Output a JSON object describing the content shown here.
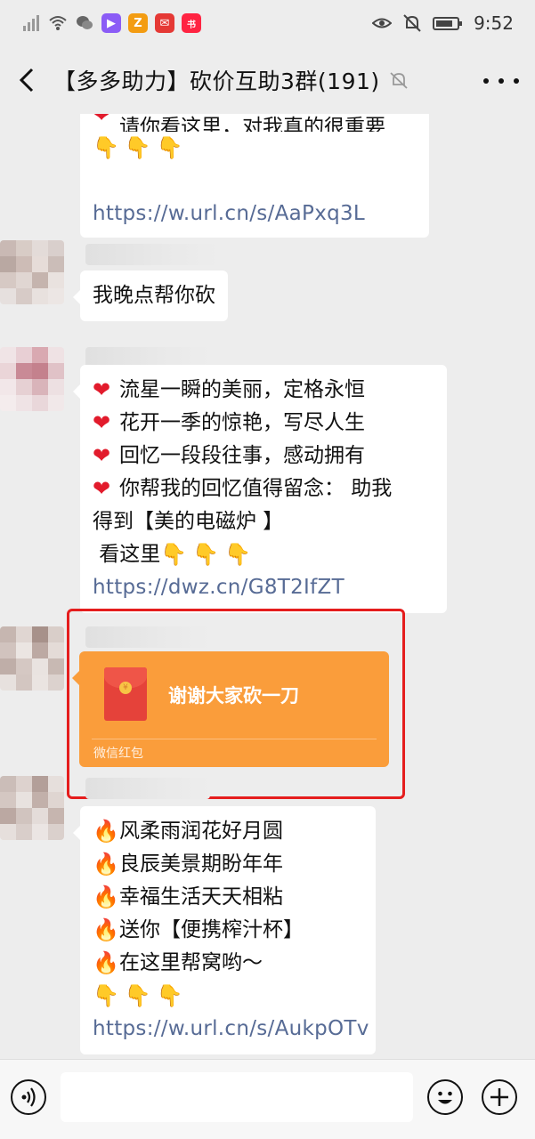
{
  "status_bar": {
    "time": "9:52",
    "app_icons": [
      {
        "name": "video-app-icon",
        "color": "#8b5cf6",
        "glyph": "▶"
      },
      {
        "name": "zhihu-app-icon",
        "color": "#f39c12",
        "glyph": "Z"
      },
      {
        "name": "red-app-icon",
        "color": "#e53935",
        "glyph": "✉"
      },
      {
        "name": "xiaohongshu-app-icon",
        "color": "#ff2442",
        "glyph": "书"
      }
    ]
  },
  "header": {
    "title": "【多多助力】砍价互助3群(191)",
    "back_icon": "back-arrow-icon",
    "mute_icon": "bell-muted-icon",
    "more_icon": "more-dots-icon"
  },
  "messages": {
    "m1": {
      "partial_line": "请你看这里，对我真的很重要",
      "hands": "👇👇👇",
      "link": "https://w.url.cn/s/AaPxq3L"
    },
    "m2": {
      "text": "我晚点帮你砍"
    },
    "m3": {
      "lines": [
        "流星一瞬的美丽，定格永恒",
        "花开一季的惊艳，写尽人生",
        "回忆一段段往事，感动拥有",
        "你帮我的回忆值得留念： 助我"
      ],
      "line5": "得到【美的电磁炉 】",
      "line6": " 看这里",
      "hands": "👇👇👇",
      "link": "https://dwz.cn/G8T2IfZT"
    },
    "red_packet": {
      "text": "谢谢大家砍一刀",
      "footer": "微信红包",
      "color": "#fa9d3b"
    },
    "m5": {
      "lines": [
        "风柔雨润花好月圆",
        "良辰美景期盼年年",
        "幸福生活天天相粘",
        "送你【便携榨汁杯】",
        "在这里帮窝哟～"
      ],
      "hands": "👇👇👇",
      "link": "https://w.url.cn/s/AukpOTv"
    }
  },
  "colors": {
    "link": "#576b95",
    "highlight_border": "#e51d1d",
    "background": "#ededed"
  }
}
